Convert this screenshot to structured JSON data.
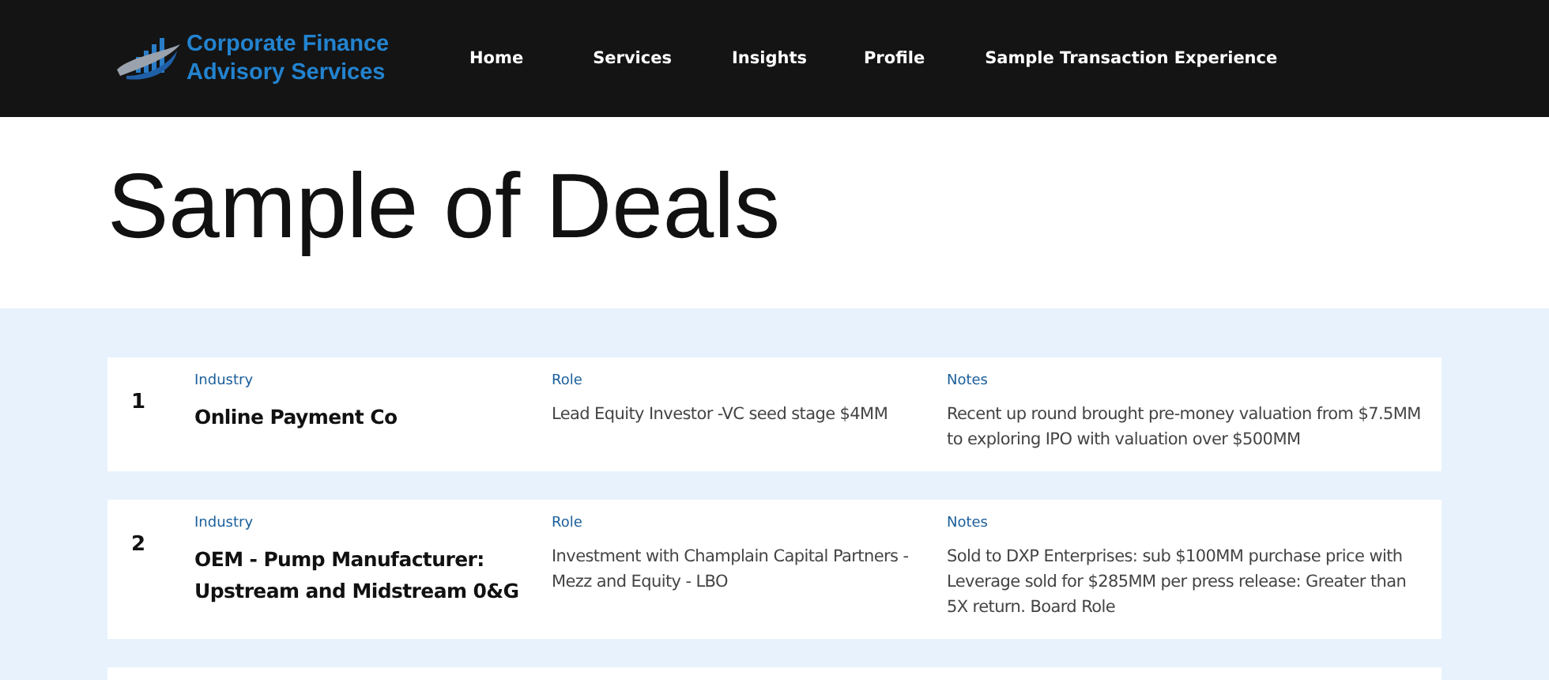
{
  "header": {
    "logo_text": [
      "Corporate Finance",
      "Advisory Services"
    ],
    "nav": [
      {
        "label": "Home"
      },
      {
        "label": "Services"
      },
      {
        "label": "Insights"
      },
      {
        "label": "Profile"
      },
      {
        "label": "Sample Transaction Experience"
      }
    ]
  },
  "page_title": "Sample of Deals",
  "deals": [
    {
      "number": "1",
      "industry_label": "Industry",
      "industry": "Online Payment Co",
      "role_label": "Role",
      "role": "Lead Equity Investor -VC seed stage $4MM",
      "notes_label": "Notes",
      "notes": "Recent up round brought pre-money valuation from $7.5MM to exploring IPO with valuation over $500MM"
    },
    {
      "number": "2",
      "industry_label": "Industry",
      "industry": "OEM - Pump Manufacturer: Upstream and Midstream 0&G",
      "role_label": "Role",
      "role": "Investment with Champlain Capital Partners - Mezz and Equity - LBO",
      "notes_label": "Notes",
      "notes": "Sold to DXP Enterprises: sub $100MM purchase price with Leverage sold for $285MM per press release: Greater than 5X return. Board Role"
    }
  ]
}
